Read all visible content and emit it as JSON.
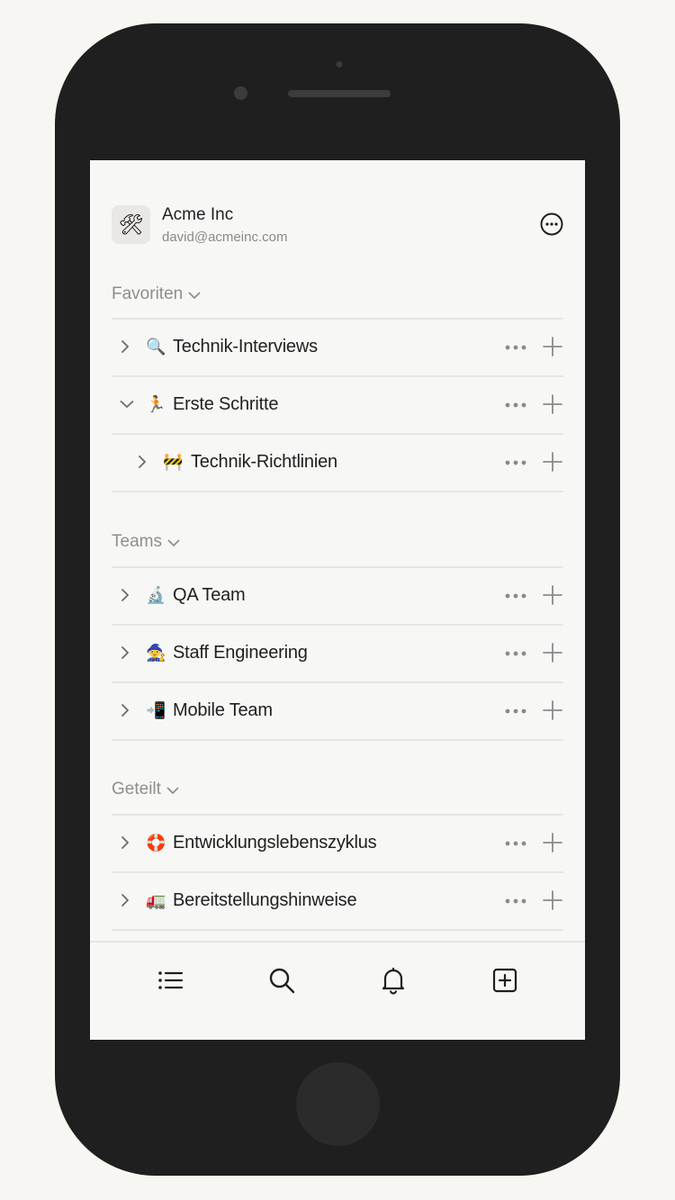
{
  "workspace": {
    "icon": "🛠",
    "name": "Acme Inc",
    "email": "david@acmeinc.com"
  },
  "sections": {
    "favorites": {
      "title": "Favoriten",
      "items": [
        {
          "emoji": "🔍",
          "label": "Technik-Interviews",
          "expanded": false,
          "indent": 0
        },
        {
          "emoji": "🏃",
          "label": "Erste Schritte",
          "expanded": true,
          "indent": 0
        },
        {
          "emoji": "🚧",
          "label": "Technik-Richtlinien",
          "expanded": false,
          "indent": 1
        }
      ]
    },
    "teams": {
      "title": "Teams",
      "items": [
        {
          "emoji": "🔬",
          "label": "QA Team",
          "expanded": false,
          "indent": 0
        },
        {
          "emoji": "🧙",
          "label": "Staff Engineering",
          "expanded": false,
          "indent": 0
        },
        {
          "emoji": "📲",
          "label": "Mobile Team",
          "expanded": false,
          "indent": 0
        }
      ]
    },
    "shared": {
      "title": "Geteilt",
      "items": [
        {
          "emoji": "🛟",
          "label": "Entwicklungslebenszyklus",
          "expanded": false,
          "indent": 0
        },
        {
          "emoji": "🚛",
          "label": "Bereitstellungshinweise",
          "expanded": false,
          "indent": 0
        }
      ]
    }
  },
  "tabbar": {
    "items": [
      "list-icon",
      "search-icon",
      "bell-icon",
      "new-page-icon"
    ]
  },
  "colors": {
    "text": "#1f1f1f",
    "muted": "#8e8e8e",
    "divider": "#e6e6e3",
    "screen_bg": "#f7f7f5",
    "phone_body": "#1f1f1f"
  }
}
